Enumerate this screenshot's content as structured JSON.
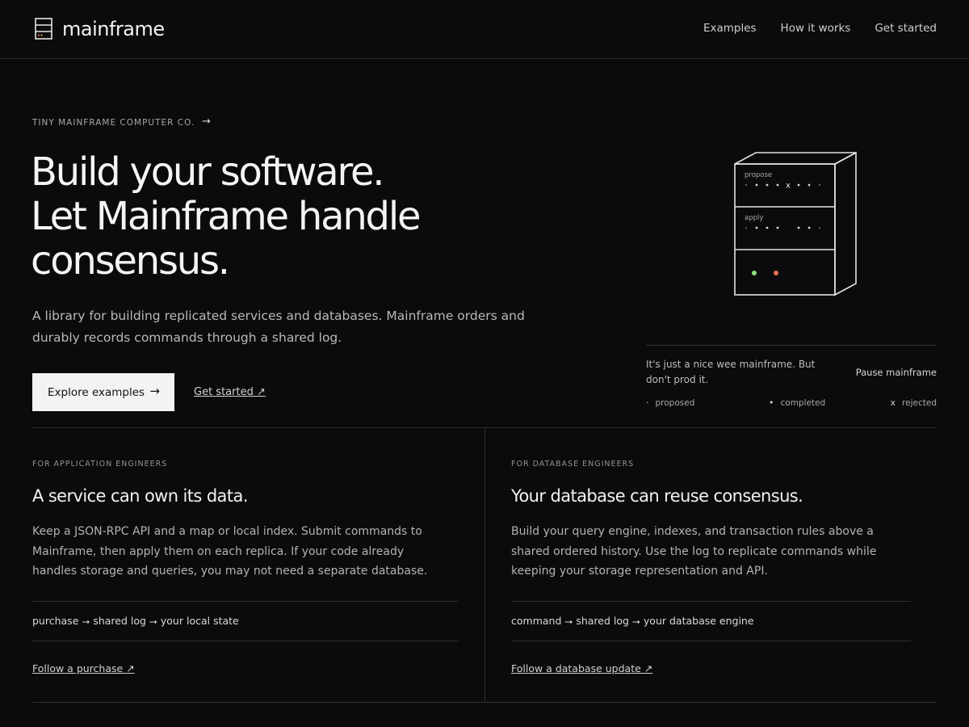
{
  "header": {
    "brand": "mainframe",
    "nav": [
      {
        "label": "Examples"
      },
      {
        "label": "How it works"
      },
      {
        "label": "Get started"
      }
    ]
  },
  "hero": {
    "eyebrow": "TINY MAINFRAME COMPUTER CO.",
    "eyebrow_arrow": "→",
    "title_lines": [
      "Build your software.",
      "Let Mainframe handle",
      "consensus."
    ],
    "subtitle": "A library for building replicated services and databases. Mainframe orders and durably records commands through a shared log.",
    "primary_button": {
      "label": "Explore examples",
      "arrow": "→"
    },
    "secondary_link": "Get started ↗"
  },
  "machine": {
    "row_labels": {
      "propose": "propose",
      "apply": "apply"
    },
    "caption": "It's just a nice wee mainframe. But don't prod it.",
    "pause_label": "Pause mainframe",
    "legend": [
      {
        "symbol": "·",
        "label": "proposed"
      },
      {
        "symbol": "•",
        "label": "completed"
      },
      {
        "symbol": "x",
        "label": "rejected"
      }
    ],
    "colors": {
      "green_light": "#8fe07a",
      "red_light": "#f0705a"
    }
  },
  "cards": [
    {
      "eyebrow": "FOR APPLICATION ENGINEERS",
      "title": "A service can own its data.",
      "body": "Keep a JSON-RPC API and a map or local index. Submit commands to Mainframe, then apply them on each replica. If your code already handles storage and queries, you may not need a separate database.",
      "flow": "purchase ⭢ shared log ⭢ your local state",
      "link": "Follow a purchase ↗"
    },
    {
      "eyebrow": "FOR DATABASE ENGINEERS",
      "title": "Your database can reuse consensus.",
      "body": "Build your query engine, indexes, and transaction rules above a shared ordered history. Use the log to replicate commands while keeping your storage representation and API.",
      "flow": "command ⭢ shared log ⭢ your database engine",
      "link": "Follow a database update ↗"
    }
  ]
}
